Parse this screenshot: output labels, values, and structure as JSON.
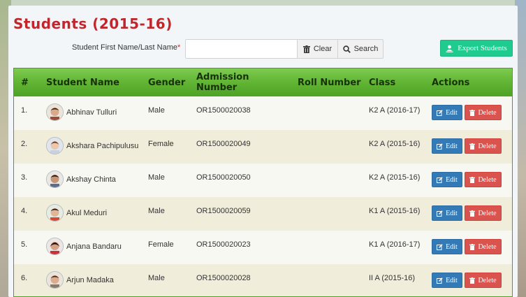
{
  "page": {
    "title": "Students (2015-16)"
  },
  "search": {
    "label": "Student First Name/Last Name",
    "required_mark": "*",
    "value": "",
    "placeholder": "",
    "clear_label": "Clear",
    "search_label": "Search"
  },
  "export": {
    "label": "Export Students"
  },
  "table": {
    "headers": [
      "#",
      "Student Name",
      "Gender",
      "Admission Number",
      "Roll Number",
      "Class",
      "Actions"
    ],
    "rows": [
      {
        "num": "1.",
        "name": "Abhinav Tulluri",
        "gender": "Male",
        "admission": "OR1500020038",
        "roll": "",
        "class": "K2 A (2016-17)"
      },
      {
        "num": "2.",
        "name": "Akshara Pachipulusu",
        "gender": "Female",
        "admission": "OR1500020049",
        "roll": "",
        "class": "K2 A (2015-16)"
      },
      {
        "num": "3.",
        "name": "Akshay Chinta",
        "gender": "Male",
        "admission": "OR1500020050",
        "roll": "",
        "class": "K2 A (2015-16)"
      },
      {
        "num": "4.",
        "name": "Akul Meduri",
        "gender": "Male",
        "admission": "OR1500020059",
        "roll": "",
        "class": "K1 A (2015-16)"
      },
      {
        "num": "5.",
        "name": "Anjana Bandaru",
        "gender": "Female",
        "admission": "OR1500020023",
        "roll": "",
        "class": "K1 A (2016-17)"
      },
      {
        "num": "6.",
        "name": "Arjun Madaka",
        "gender": "Male",
        "admission": "OR1500020028",
        "roll": "",
        "class": "II A (2015-16)"
      }
    ],
    "edit_label": "Edit",
    "delete_label": "Delete"
  },
  "colors": {
    "title": "#c0272d",
    "header_green": "#5fb232",
    "export": "#1fcb8e",
    "edit": "#337ab7",
    "delete": "#d9534f"
  },
  "icons": {
    "clear": "trash-icon",
    "search": "search-icon",
    "export": "user-export-icon",
    "edit": "edit-icon",
    "delete": "trash-icon",
    "avatar": "student-avatar"
  }
}
